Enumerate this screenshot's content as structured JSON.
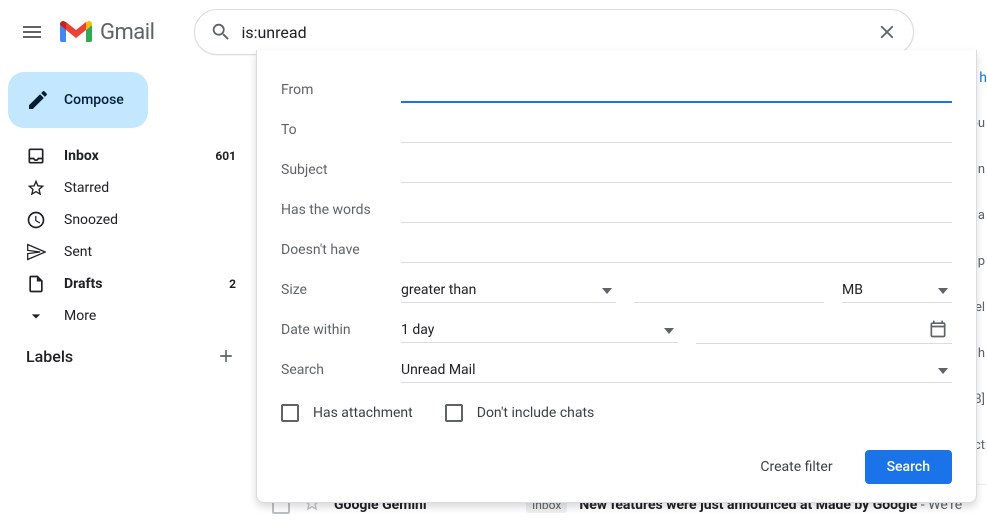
{
  "header": {
    "app_name": "Gmail",
    "search_value": "is:unread"
  },
  "compose_label": "Compose",
  "nav": [
    {
      "icon": "inbox",
      "label": "Inbox",
      "count": "601",
      "bold": true
    },
    {
      "icon": "star",
      "label": "Starred",
      "count": "",
      "bold": false
    },
    {
      "icon": "clock",
      "label": "Snoozed",
      "count": "",
      "bold": false
    },
    {
      "icon": "send",
      "label": "Sent",
      "count": "",
      "bold": false
    },
    {
      "icon": "file",
      "label": "Drafts",
      "count": "2",
      "bold": true
    },
    {
      "icon": "chevron",
      "label": "More",
      "count": "",
      "bold": false
    }
  ],
  "labels_header": "Labels",
  "search_form": {
    "from_label": "From",
    "to_label": "To",
    "subject_label": "Subject",
    "has_words_label": "Has the words",
    "doesnt_have_label": "Doesn't have",
    "size_label": "Size",
    "size_comparator": "greater than",
    "size_unit": "MB",
    "date_label": "Date within",
    "date_range": "1 day",
    "search_scope_label": "Search",
    "search_scope_value": "Unread Mail",
    "has_attachment_label": "Has attachment",
    "exclude_chats_label": "Don't include chats",
    "create_filter_label": "Create filter",
    "search_button_label": "Search"
  },
  "visible_row": {
    "sender": "Google Gemini",
    "chip": "Inbox",
    "subject": "New features were just announced at Made by Google",
    "snippet": " - We're"
  },
  "bg_peek": "h",
  "bg_chars": [
    "ou",
    "n",
    "l a",
    "ap",
    "el",
    "h",
    "8]",
    "ct"
  ]
}
